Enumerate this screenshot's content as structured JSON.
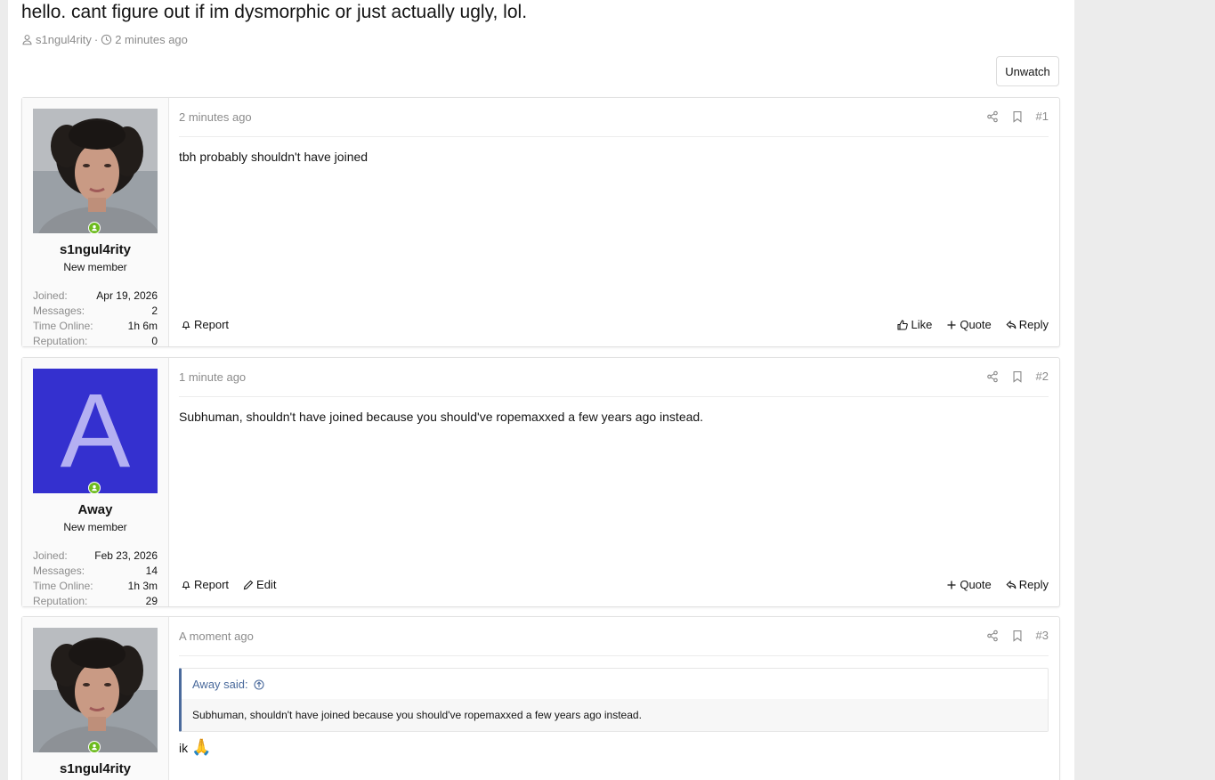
{
  "thread": {
    "title": "hello. cant figure out if im dysmorphic or just actually ugly, lol.",
    "author": "s1ngul4rity",
    "separator": "·",
    "time": "2 minutes ago",
    "unwatch_label": "Unwatch"
  },
  "labels": {
    "joined": "Joined:",
    "messages": "Messages:",
    "time_online": "Time Online:",
    "reputation": "Reputation:",
    "report": "Report",
    "edit": "Edit",
    "like": "Like",
    "quote": "Quote",
    "reply": "Reply"
  },
  "posts": [
    {
      "number": "#1",
      "time": "2 minutes ago",
      "body": "tbh probably shouldn't have joined",
      "user": {
        "name": "s1ngul4rity",
        "title": "New member",
        "joined": "Apr 19, 2026",
        "messages": "2",
        "time_online": "1h 6m",
        "reputation": "0"
      }
    },
    {
      "number": "#2",
      "time": "1 minute ago",
      "body": "Subhuman, shouldn't have joined because you should've ropemaxxed a few years ago instead.",
      "user": {
        "name": "Away",
        "avatar_letter": "A",
        "title": "New member",
        "joined": "Feb 23, 2026",
        "messages": "14",
        "time_online": "1h 3m",
        "reputation": "29"
      }
    },
    {
      "number": "#3",
      "time": "A moment ago",
      "quote_author": "Away said:",
      "quote_text": "Subhuman, shouldn't have joined because you should've ropemaxxed a few years ago instead.",
      "body": "ik",
      "body_emoji": "🙏",
      "user": {
        "name": "s1ngul4rity"
      }
    }
  ],
  "colors": {
    "accent_link": "#4a6a9c",
    "online_green": "#6dbb1e",
    "avatar_bg": "#3430cf",
    "avatar_letter": "#b4b0f2"
  }
}
